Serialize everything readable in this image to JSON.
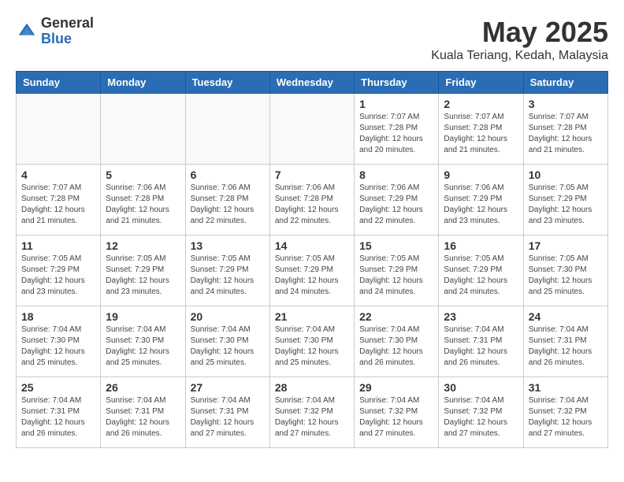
{
  "logo": {
    "general": "General",
    "blue": "Blue"
  },
  "title": {
    "month": "May 2025",
    "location": "Kuala Teriang, Kedah, Malaysia"
  },
  "headers": [
    "Sunday",
    "Monday",
    "Tuesday",
    "Wednesday",
    "Thursday",
    "Friday",
    "Saturday"
  ],
  "weeks": [
    [
      {
        "day": "",
        "info": ""
      },
      {
        "day": "",
        "info": ""
      },
      {
        "day": "",
        "info": ""
      },
      {
        "day": "",
        "info": ""
      },
      {
        "day": "1",
        "info": "Sunrise: 7:07 AM\nSunset: 7:28 PM\nDaylight: 12 hours\nand 20 minutes."
      },
      {
        "day": "2",
        "info": "Sunrise: 7:07 AM\nSunset: 7:28 PM\nDaylight: 12 hours\nand 21 minutes."
      },
      {
        "day": "3",
        "info": "Sunrise: 7:07 AM\nSunset: 7:28 PM\nDaylight: 12 hours\nand 21 minutes."
      }
    ],
    [
      {
        "day": "4",
        "info": "Sunrise: 7:07 AM\nSunset: 7:28 PM\nDaylight: 12 hours\nand 21 minutes."
      },
      {
        "day": "5",
        "info": "Sunrise: 7:06 AM\nSunset: 7:28 PM\nDaylight: 12 hours\nand 21 minutes."
      },
      {
        "day": "6",
        "info": "Sunrise: 7:06 AM\nSunset: 7:28 PM\nDaylight: 12 hours\nand 22 minutes."
      },
      {
        "day": "7",
        "info": "Sunrise: 7:06 AM\nSunset: 7:28 PM\nDaylight: 12 hours\nand 22 minutes."
      },
      {
        "day": "8",
        "info": "Sunrise: 7:06 AM\nSunset: 7:29 PM\nDaylight: 12 hours\nand 22 minutes."
      },
      {
        "day": "9",
        "info": "Sunrise: 7:06 AM\nSunset: 7:29 PM\nDaylight: 12 hours\nand 23 minutes."
      },
      {
        "day": "10",
        "info": "Sunrise: 7:05 AM\nSunset: 7:29 PM\nDaylight: 12 hours\nand 23 minutes."
      }
    ],
    [
      {
        "day": "11",
        "info": "Sunrise: 7:05 AM\nSunset: 7:29 PM\nDaylight: 12 hours\nand 23 minutes."
      },
      {
        "day": "12",
        "info": "Sunrise: 7:05 AM\nSunset: 7:29 PM\nDaylight: 12 hours\nand 23 minutes."
      },
      {
        "day": "13",
        "info": "Sunrise: 7:05 AM\nSunset: 7:29 PM\nDaylight: 12 hours\nand 24 minutes."
      },
      {
        "day": "14",
        "info": "Sunrise: 7:05 AM\nSunset: 7:29 PM\nDaylight: 12 hours\nand 24 minutes."
      },
      {
        "day": "15",
        "info": "Sunrise: 7:05 AM\nSunset: 7:29 PM\nDaylight: 12 hours\nand 24 minutes."
      },
      {
        "day": "16",
        "info": "Sunrise: 7:05 AM\nSunset: 7:29 PM\nDaylight: 12 hours\nand 24 minutes."
      },
      {
        "day": "17",
        "info": "Sunrise: 7:05 AM\nSunset: 7:30 PM\nDaylight: 12 hours\nand 25 minutes."
      }
    ],
    [
      {
        "day": "18",
        "info": "Sunrise: 7:04 AM\nSunset: 7:30 PM\nDaylight: 12 hours\nand 25 minutes."
      },
      {
        "day": "19",
        "info": "Sunrise: 7:04 AM\nSunset: 7:30 PM\nDaylight: 12 hours\nand 25 minutes."
      },
      {
        "day": "20",
        "info": "Sunrise: 7:04 AM\nSunset: 7:30 PM\nDaylight: 12 hours\nand 25 minutes."
      },
      {
        "day": "21",
        "info": "Sunrise: 7:04 AM\nSunset: 7:30 PM\nDaylight: 12 hours\nand 25 minutes."
      },
      {
        "day": "22",
        "info": "Sunrise: 7:04 AM\nSunset: 7:30 PM\nDaylight: 12 hours\nand 26 minutes."
      },
      {
        "day": "23",
        "info": "Sunrise: 7:04 AM\nSunset: 7:31 PM\nDaylight: 12 hours\nand 26 minutes."
      },
      {
        "day": "24",
        "info": "Sunrise: 7:04 AM\nSunset: 7:31 PM\nDaylight: 12 hours\nand 26 minutes."
      }
    ],
    [
      {
        "day": "25",
        "info": "Sunrise: 7:04 AM\nSunset: 7:31 PM\nDaylight: 12 hours\nand 26 minutes."
      },
      {
        "day": "26",
        "info": "Sunrise: 7:04 AM\nSunset: 7:31 PM\nDaylight: 12 hours\nand 26 minutes."
      },
      {
        "day": "27",
        "info": "Sunrise: 7:04 AM\nSunset: 7:31 PM\nDaylight: 12 hours\nand 27 minutes."
      },
      {
        "day": "28",
        "info": "Sunrise: 7:04 AM\nSunset: 7:32 PM\nDaylight: 12 hours\nand 27 minutes."
      },
      {
        "day": "29",
        "info": "Sunrise: 7:04 AM\nSunset: 7:32 PM\nDaylight: 12 hours\nand 27 minutes."
      },
      {
        "day": "30",
        "info": "Sunrise: 7:04 AM\nSunset: 7:32 PM\nDaylight: 12 hours\nand 27 minutes."
      },
      {
        "day": "31",
        "info": "Sunrise: 7:04 AM\nSunset: 7:32 PM\nDaylight: 12 hours\nand 27 minutes."
      }
    ]
  ]
}
